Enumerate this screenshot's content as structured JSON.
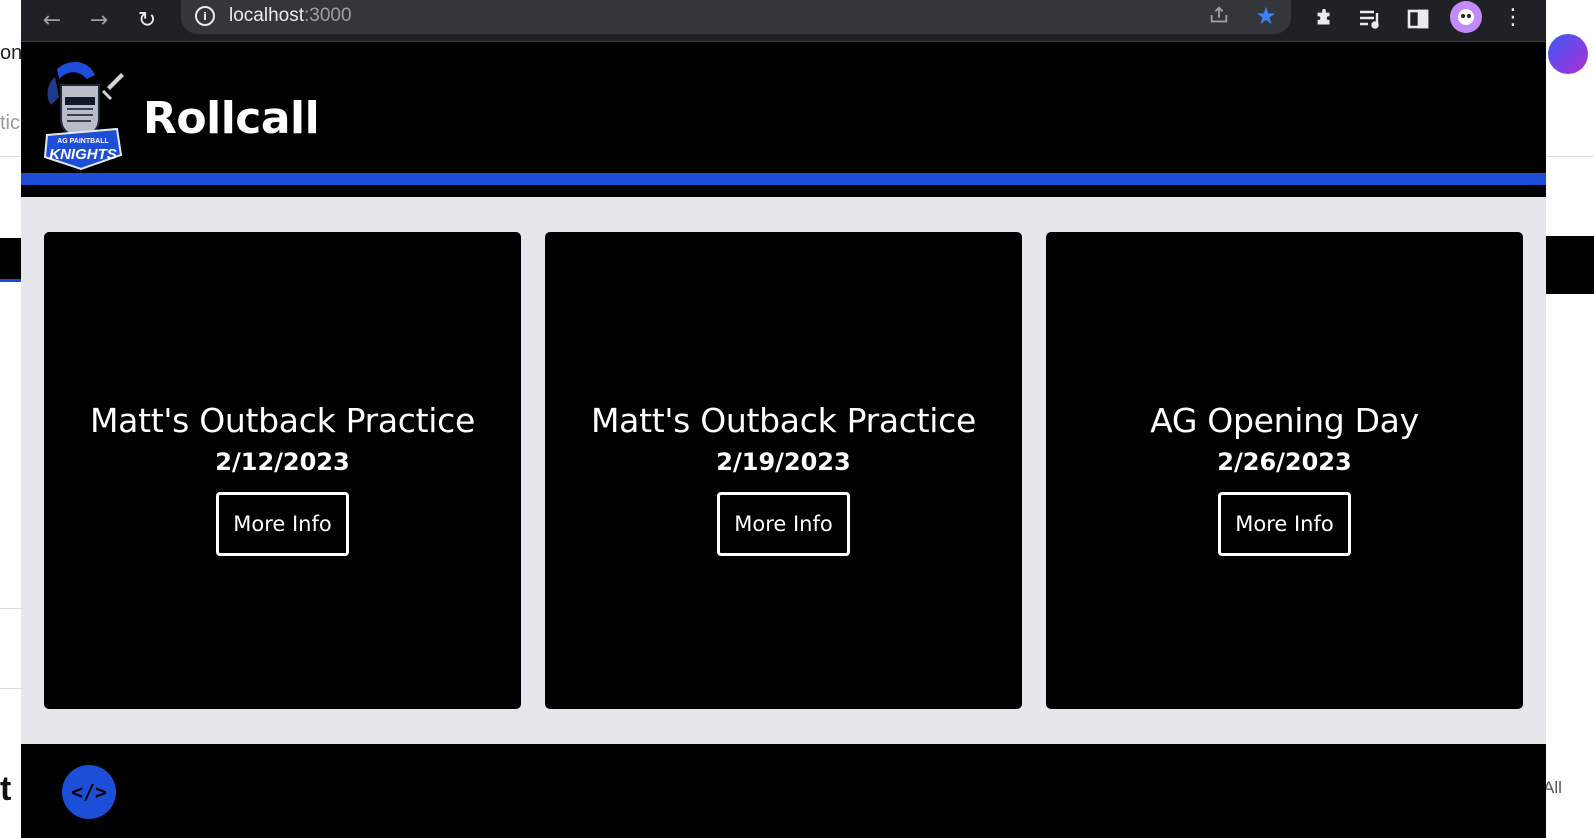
{
  "background": {
    "left_text_top": "on",
    "left_text_mid": "tic",
    "left_text_bottom": "t",
    "right_text_bottom": "All"
  },
  "browser": {
    "url_host": "localhost",
    "url_port": ":3000",
    "info_icon": "info-icon",
    "bookmark_starred": true
  },
  "site": {
    "title": "Rollcall",
    "logo_name": "AG Paintball Knights",
    "accent_color": "#1d4ed8",
    "header_bg": "#000000",
    "main_bg": "#e5e7eb"
  },
  "events": [
    {
      "title": "Matt's Outback Practice",
      "date": "2/12/2023",
      "button_label": "More Info"
    },
    {
      "title": "Matt's Outback Practice",
      "date": "2/19/2023",
      "button_label": "More Info"
    },
    {
      "title": "AG Opening Day",
      "date": "2/26/2023",
      "button_label": "More Info"
    }
  ],
  "footer": {
    "code_button_label": "</>"
  }
}
